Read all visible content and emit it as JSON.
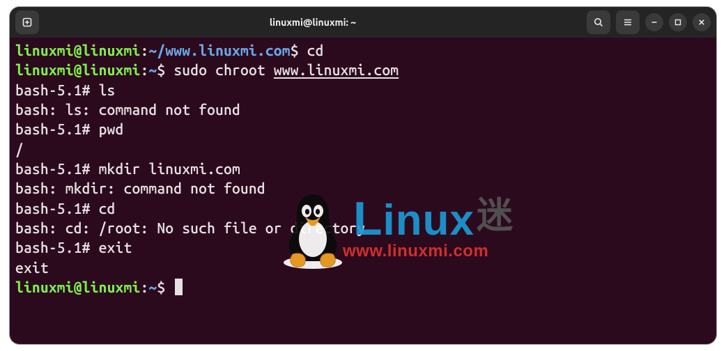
{
  "titlebar": {
    "title": "linuxmi@linuxmi: ~"
  },
  "prompt": {
    "user": "linuxmi",
    "at": "@",
    "host": "linuxmi",
    "home_sig": "~",
    "dollar": "$"
  },
  "lines": {
    "l1_path": "~/www.linuxmi.com",
    "l1_cmd": "cd",
    "l2_path": "~",
    "l2_cmd": "sudo chroot ",
    "l2_cmd_ul": "www.linuxmi.com",
    "l3": "bash-5.1# ls",
    "l4": "bash: ls: command not found",
    "l5": "bash-5.1# pwd",
    "l6": "/",
    "l7": "bash-5.1# mkdir linuxmi.com",
    "l8": "bash: mkdir: command not found",
    "l9": "bash-5.1# cd",
    "l10": "bash: cd: /root: No such file or directory",
    "l11": "bash-5.1# exit",
    "l12": "exit",
    "l13_path": "~"
  },
  "watermark": {
    "brand": "Linux",
    "cn": "迷",
    "url": "www.linuxmi.com"
  }
}
